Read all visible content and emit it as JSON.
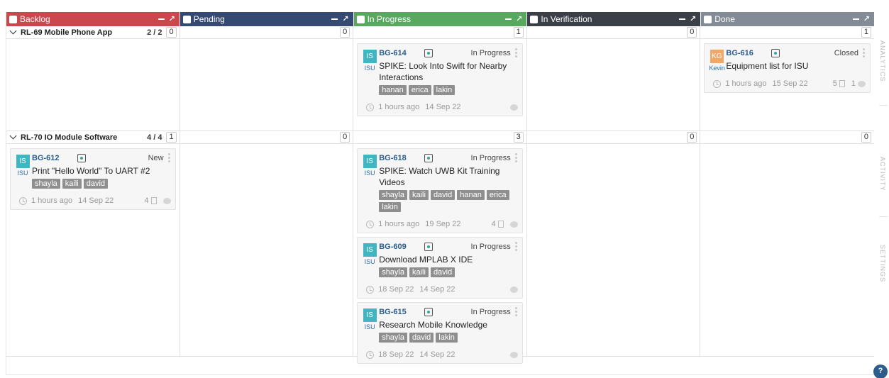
{
  "columns": [
    {
      "title": "Backlog",
      "color": "#c9474d"
    },
    {
      "title": "Pending",
      "color": "#344a73"
    },
    {
      "title": "In Progress",
      "color": "#58a95f"
    },
    {
      "title": "In Verification",
      "color": "#3b3f48"
    },
    {
      "title": "Done",
      "color": "#838b96"
    }
  ],
  "swimlanes": [
    {
      "name": "RL-69 Mobile Phone App",
      "ratio": "2 / 2",
      "counts": [
        "0",
        "0",
        "1",
        "0",
        "1"
      ],
      "cards": [
        [],
        [],
        [
          {
            "id": "BG-614",
            "avatar": "IS",
            "avatar_color": "#3fb6c2",
            "user": "ISU",
            "status": "In Progress",
            "title": "SPIKE: Look Into Swift for Nearby Interactions",
            "tags": [
              "hanan",
              "erica",
              "lakin"
            ],
            "age": "1 hours ago",
            "date": "14 Sep 22",
            "comments": ""
          }
        ],
        [],
        [
          {
            "id": "BG-616",
            "avatar": "KG",
            "avatar_color": "#f0a86a",
            "user": "Kevin",
            "status": "Closed",
            "title": "Equipment list for ISU",
            "tags": [],
            "age": "1 hours ago",
            "date": "15 Sep 22",
            "comments": "5",
            "extra": "1"
          }
        ]
      ]
    },
    {
      "name": "RL-70 IO Module Software",
      "ratio": "4 / 4",
      "counts": [
        "1",
        "0",
        "3",
        "0",
        "0"
      ],
      "cards": [
        [
          {
            "id": "BG-612",
            "avatar": "IS",
            "avatar_color": "#3fb6c2",
            "user": "ISU",
            "status": "New",
            "title": "Print \"Hello World\" To UART #2",
            "tags": [
              "shayla",
              "kaili",
              "david"
            ],
            "age": "1 hours ago",
            "date": "14 Sep 22",
            "comments": "4"
          }
        ],
        [],
        [
          {
            "id": "BG-618",
            "avatar": "IS",
            "avatar_color": "#3fb6c2",
            "user": "ISU",
            "status": "In Progress",
            "title": "SPIKE: Watch UWB Kit Training Videos",
            "tags": [
              "shayla",
              "kaili",
              "david",
              "hanan",
              "erica",
              "lakin"
            ],
            "age": "1 hours ago",
            "date": "19 Sep 22",
            "comments": "4"
          },
          {
            "id": "BG-609",
            "avatar": "IS",
            "avatar_color": "#3fb6c2",
            "user": "ISU",
            "status": "In Progress",
            "title": "Download MPLAB X IDE",
            "tags": [
              "shayla",
              "kaili",
              "david"
            ],
            "age": "18 Sep 22",
            "date": "14 Sep 22",
            "comments": ""
          },
          {
            "id": "BG-615",
            "avatar": "IS",
            "avatar_color": "#3fb6c2",
            "user": "ISU",
            "status": "In Progress",
            "title": "Research Mobile Knowledge",
            "tags": [
              "shayla",
              "david",
              "lakin"
            ],
            "age": "18 Sep 22",
            "date": "14 Sep 22",
            "comments": ""
          }
        ],
        [],
        []
      ]
    }
  ],
  "sidebar": {
    "tabs": [
      "ANALYTICS",
      "ACTIVITY",
      "SETTINGS"
    ],
    "help": "?"
  }
}
